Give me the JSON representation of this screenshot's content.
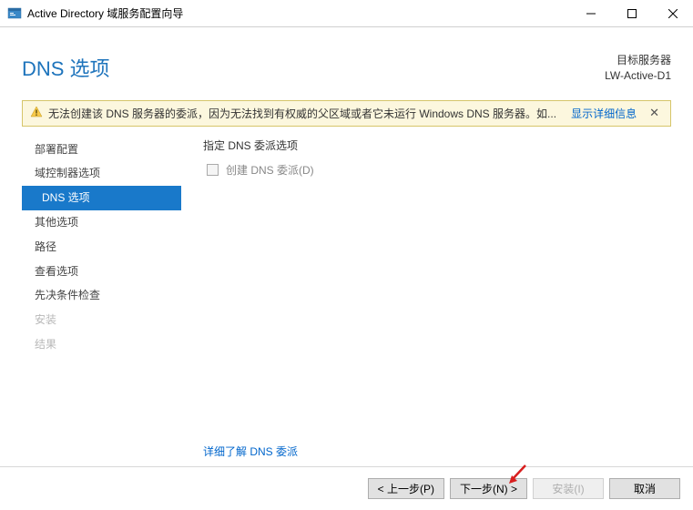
{
  "window": {
    "title": "Active Directory 域服务配置向导"
  },
  "header": {
    "page_title": "DNS 选项",
    "server_label": "目标服务器",
    "server_name": "LW-Active-D1"
  },
  "warning": {
    "text": "无法创建该 DNS 服务器的委派，因为无法找到有权威的父区域或者它未运行 Windows DNS 服务器。如...",
    "link": "显示详细信息"
  },
  "sidebar": {
    "items": [
      {
        "label": "部署配置",
        "state": "normal"
      },
      {
        "label": "域控制器选项",
        "state": "normal"
      },
      {
        "label": "DNS 选项",
        "state": "active"
      },
      {
        "label": "其他选项",
        "state": "normal"
      },
      {
        "label": "路径",
        "state": "normal"
      },
      {
        "label": "查看选项",
        "state": "normal"
      },
      {
        "label": "先决条件检查",
        "state": "normal"
      },
      {
        "label": "安装",
        "state": "disabled"
      },
      {
        "label": "结果",
        "state": "disabled"
      }
    ]
  },
  "main": {
    "section_label": "指定 DNS 委派选项",
    "checkbox_label": "创建 DNS 委派(D)",
    "learn_more": "详细了解 DNS 委派"
  },
  "buttons": {
    "prev": "< 上一步(P)",
    "next": "下一步(N) >",
    "install": "安装(I)",
    "cancel": "取消"
  }
}
